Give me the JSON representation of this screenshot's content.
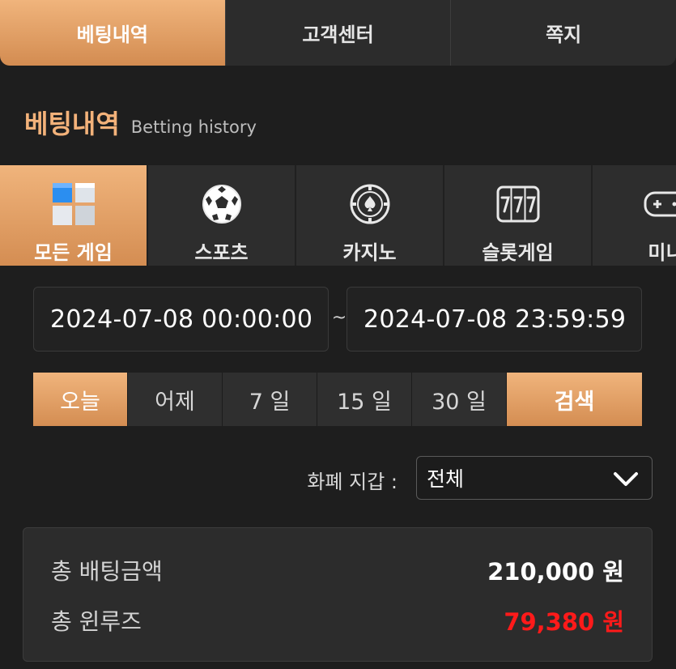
{
  "top_tabs": [
    {
      "label": "베팅내역",
      "active": true
    },
    {
      "label": "고객센터",
      "active": false
    },
    {
      "label": "쪽지",
      "active": false
    }
  ],
  "heading": {
    "title": "베팅내역",
    "subtitle": "Betting history"
  },
  "game_tabs": [
    {
      "label": "모든 게임",
      "icon": "cube-grid-icon",
      "active": true
    },
    {
      "label": "스포츠",
      "icon": "soccer-ball-icon",
      "active": false
    },
    {
      "label": "카지노",
      "icon": "poker-chip-icon",
      "active": false
    },
    {
      "label": "슬롯게임",
      "icon": "slot-777-icon",
      "active": false
    },
    {
      "label": "미니",
      "icon": "gamepad-icon",
      "active": false
    }
  ],
  "date_range": {
    "start": "2024-07-08 00:00:00",
    "separator": "~",
    "end": "2024-07-08 23:59:59"
  },
  "quick_filters": [
    {
      "label": "오늘",
      "active": true
    },
    {
      "label": "어제",
      "active": false
    },
    {
      "label": "7 일",
      "active": false
    },
    {
      "label": "15 일",
      "active": false
    },
    {
      "label": "30 일",
      "active": false
    }
  ],
  "search_label": "검색",
  "wallet": {
    "label": "화폐 지갑 :",
    "selected": "전체"
  },
  "summary": {
    "total_bet_label": "총 배팅금액",
    "total_bet_value": "210,000 원",
    "total_winloss_label": "총 윈루즈",
    "total_winloss_value": "79,380 원"
  },
  "colors": {
    "accent": "#e8a46a",
    "background": "#1e1e1e",
    "negative": "#ff1a1a"
  }
}
